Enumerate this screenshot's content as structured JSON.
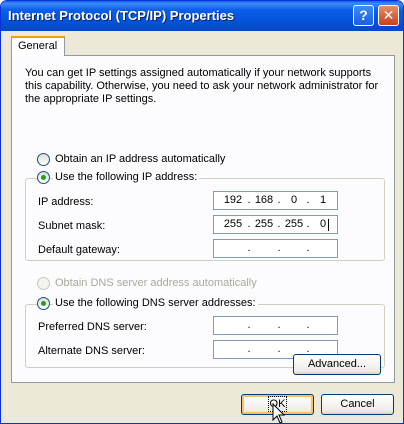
{
  "window": {
    "title": "Internet Protocol (TCP/IP) Properties",
    "help_label": "?",
    "close_label": "✕"
  },
  "tabs": [
    {
      "label": "General",
      "selected": true
    }
  ],
  "description": "You can get IP settings assigned automatically if your network supports this capability. Otherwise, you need to ask your network administrator for the appropriate IP settings.",
  "ip_mode": {
    "auto_label": "Obtain an IP address automatically",
    "manual_label": "Use the following IP address:",
    "selected": "manual"
  },
  "ip_fields": {
    "ip_address": {
      "label": "IP address:",
      "octets": [
        "192",
        "168",
        "0",
        "1"
      ]
    },
    "subnet_mask": {
      "label": "Subnet mask:",
      "octets": [
        "255",
        "255",
        "255",
        "0"
      ]
    },
    "default_gateway": {
      "label": "Default gateway:",
      "octets": [
        "",
        "",
        "",
        ""
      ]
    }
  },
  "dns_mode": {
    "auto_label": "Obtain DNS server address automatically",
    "manual_label": "Use the following DNS server addresses:",
    "selected": "manual",
    "auto_disabled": true
  },
  "dns_fields": {
    "preferred": {
      "label": "Preferred DNS server:",
      "octets": [
        "",
        "",
        "",
        ""
      ]
    },
    "alternate": {
      "label": "Alternate DNS server:",
      "octets": [
        "",
        "",
        "",
        ""
      ]
    }
  },
  "buttons": {
    "advanced": "Advanced...",
    "ok": "OK",
    "cancel": "Cancel"
  },
  "icons": {
    "help": "help-icon",
    "close": "close-icon",
    "pointer": "mouse-pointer-icon"
  }
}
